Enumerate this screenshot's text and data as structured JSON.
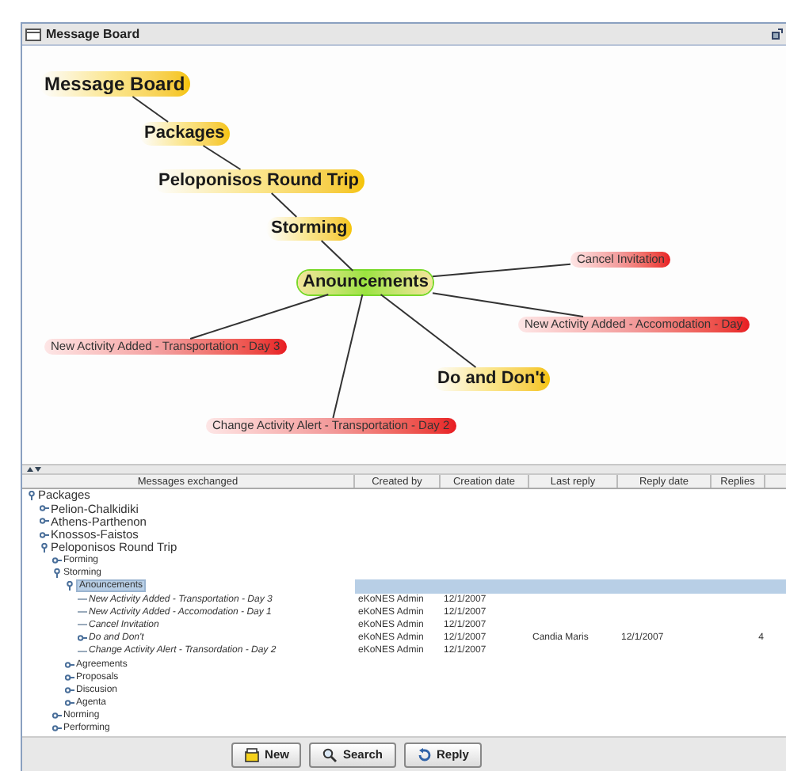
{
  "window": {
    "title": "Message Board"
  },
  "graph": {
    "nodes": [
      {
        "label": "Message Board",
        "kind": "topic",
        "selected": false,
        "children": [
          {
            "label": "Packages",
            "kind": "topic",
            "selected": false,
            "children": [
              {
                "label": "Peloponisos Round Trip",
                "kind": "topic",
                "selected": false,
                "children": [
                  {
                    "label": "Storming",
                    "kind": "topic",
                    "selected": false,
                    "children": [
                      {
                        "label": "Anouncements",
                        "kind": "topic",
                        "selected": true,
                        "children": [
                          {
                            "label": "Cancel Invitation",
                            "kind": "message",
                            "selected": false
                          },
                          {
                            "label": "New Activity Added - Accomodation - Day",
                            "kind": "message",
                            "selected": false
                          },
                          {
                            "label": "New Activity Added - Transportation - Day 3",
                            "kind": "message",
                            "selected": false
                          },
                          {
                            "label": "Do and Don't",
                            "kind": "topic",
                            "selected": false
                          },
                          {
                            "label": "Change Activity Alert - Transportation - Day 2",
                            "kind": "message",
                            "selected": false
                          }
                        ]
                      }
                    ]
                  }
                ]
              }
            ]
          }
        ]
      }
    ]
  },
  "table": {
    "columns": [
      "Messages exchanged",
      "Created by",
      "Creation date",
      "Last reply",
      "Reply date",
      "Replies"
    ],
    "rows": [
      {
        "label": "Packages",
        "kind": "folder",
        "expanded": true,
        "selected": false,
        "children": [
          {
            "label": "Pelion-Chalkidiki",
            "kind": "folder",
            "expanded": false,
            "selected": false
          },
          {
            "label": "Athens-Parthenon",
            "kind": "folder",
            "expanded": false,
            "selected": false
          },
          {
            "label": "Knossos-Faistos",
            "kind": "folder",
            "expanded": false,
            "selected": false
          },
          {
            "label": "Peloponisos Round Trip",
            "kind": "folder",
            "expanded": true,
            "selected": false,
            "children": [
              {
                "label": "Forming",
                "kind": "folder",
                "expanded": false,
                "selected": false
              },
              {
                "label": "Storming",
                "kind": "folder",
                "expanded": true,
                "selected": false,
                "children": [
                  {
                    "label": "Anouncements",
                    "kind": "folder",
                    "expanded": true,
                    "selected": true,
                    "children": [
                      {
                        "label": "New Activity Added - Transportation - Day 3",
                        "kind": "message",
                        "selected": false,
                        "cells": [
                          "eKoNES Admin",
                          "12/1/2007"
                        ]
                      },
                      {
                        "label": "New Activity Added - Accomodation - Day 1",
                        "kind": "message",
                        "selected": false,
                        "cells": [
                          "eKoNES Admin",
                          "12/1/2007"
                        ]
                      },
                      {
                        "label": "Cancel Invitation",
                        "kind": "message",
                        "selected": false,
                        "cells": [
                          "eKoNES Admin",
                          "12/1/2007"
                        ]
                      },
                      {
                        "label": "Do and Don't",
                        "kind": "thread",
                        "expanded": false,
                        "selected": false,
                        "cells": [
                          "eKoNES Admin",
                          "12/1/2007",
                          "Candia Maris",
                          "12/1/2007",
                          "4"
                        ]
                      },
                      {
                        "label": "Change Activity Alert - Transordation - Day 2",
                        "kind": "message",
                        "selected": false,
                        "cells": [
                          "eKoNES Admin",
                          "12/1/2007"
                        ]
                      }
                    ]
                  },
                  {
                    "label": "Agreements",
                    "kind": "folder",
                    "expanded": false,
                    "selected": false
                  },
                  {
                    "label": "Proposals",
                    "kind": "folder",
                    "expanded": false,
                    "selected": false
                  },
                  {
                    "label": "Discusion",
                    "kind": "folder",
                    "expanded": false,
                    "selected": false
                  },
                  {
                    "label": "Agenta",
                    "kind": "folder",
                    "expanded": false,
                    "selected": false
                  }
                ]
              },
              {
                "label": "Norming",
                "kind": "folder",
                "expanded": false,
                "selected": false
              },
              {
                "label": "Performing",
                "kind": "folder",
                "expanded": false,
                "selected": false
              }
            ]
          }
        ]
      }
    ]
  },
  "buttons": [
    {
      "label": "New",
      "kind": "new"
    },
    {
      "label": "Search",
      "kind": "search"
    },
    {
      "label": "Reply",
      "kind": "reply"
    }
  ]
}
